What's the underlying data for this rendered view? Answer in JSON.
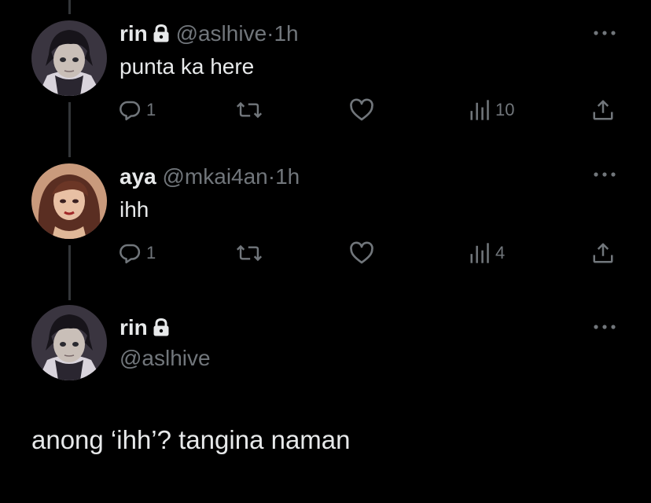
{
  "posts": [
    {
      "name": "rin",
      "handle": "@aslhive",
      "separator": "·",
      "time": "1h",
      "text": "punta ka here",
      "replies": "1",
      "views": "10"
    },
    {
      "name": "aya",
      "handle": "@mkai4an",
      "separator": "·",
      "time": "1h",
      "text": "ihh",
      "replies": "1",
      "views": "4"
    }
  ],
  "main_post": {
    "name": "rin",
    "handle": "@aslhive",
    "text": "anong ‘ihh’? tangina naman"
  },
  "icons": {
    "lock": "lock-icon",
    "more": "more-icon",
    "reply": "reply-icon",
    "repost": "repost-icon",
    "like": "heart-icon",
    "views": "views-icon",
    "share": "share-icon"
  },
  "colors": {
    "background": "#000000",
    "text": "#e7e9ea",
    "muted": "#71767b",
    "thread_line": "#333639"
  }
}
